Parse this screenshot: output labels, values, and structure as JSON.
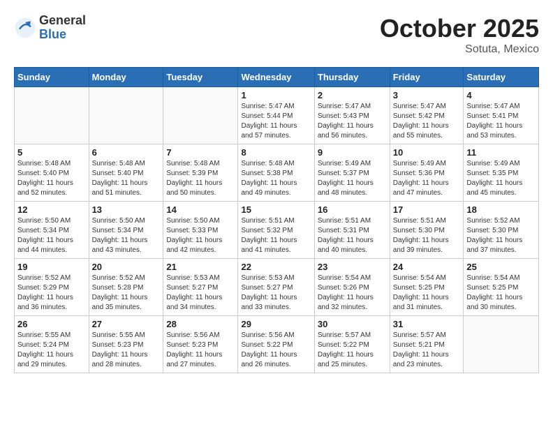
{
  "logo": {
    "general": "General",
    "blue": "Blue"
  },
  "title": "October 2025",
  "subtitle": "Sotuta, Mexico",
  "days_of_week": [
    "Sunday",
    "Monday",
    "Tuesday",
    "Wednesday",
    "Thursday",
    "Friday",
    "Saturday"
  ],
  "weeks": [
    [
      {
        "day": "",
        "info": ""
      },
      {
        "day": "",
        "info": ""
      },
      {
        "day": "",
        "info": ""
      },
      {
        "day": "1",
        "info": "Sunrise: 5:47 AM\nSunset: 5:44 PM\nDaylight: 11 hours\nand 57 minutes."
      },
      {
        "day": "2",
        "info": "Sunrise: 5:47 AM\nSunset: 5:43 PM\nDaylight: 11 hours\nand 56 minutes."
      },
      {
        "day": "3",
        "info": "Sunrise: 5:47 AM\nSunset: 5:42 PM\nDaylight: 11 hours\nand 55 minutes."
      },
      {
        "day": "4",
        "info": "Sunrise: 5:47 AM\nSunset: 5:41 PM\nDaylight: 11 hours\nand 53 minutes."
      }
    ],
    [
      {
        "day": "5",
        "info": "Sunrise: 5:48 AM\nSunset: 5:40 PM\nDaylight: 11 hours\nand 52 minutes."
      },
      {
        "day": "6",
        "info": "Sunrise: 5:48 AM\nSunset: 5:40 PM\nDaylight: 11 hours\nand 51 minutes."
      },
      {
        "day": "7",
        "info": "Sunrise: 5:48 AM\nSunset: 5:39 PM\nDaylight: 11 hours\nand 50 minutes."
      },
      {
        "day": "8",
        "info": "Sunrise: 5:48 AM\nSunset: 5:38 PM\nDaylight: 11 hours\nand 49 minutes."
      },
      {
        "day": "9",
        "info": "Sunrise: 5:49 AM\nSunset: 5:37 PM\nDaylight: 11 hours\nand 48 minutes."
      },
      {
        "day": "10",
        "info": "Sunrise: 5:49 AM\nSunset: 5:36 PM\nDaylight: 11 hours\nand 47 minutes."
      },
      {
        "day": "11",
        "info": "Sunrise: 5:49 AM\nSunset: 5:35 PM\nDaylight: 11 hours\nand 45 minutes."
      }
    ],
    [
      {
        "day": "12",
        "info": "Sunrise: 5:50 AM\nSunset: 5:34 PM\nDaylight: 11 hours\nand 44 minutes."
      },
      {
        "day": "13",
        "info": "Sunrise: 5:50 AM\nSunset: 5:34 PM\nDaylight: 11 hours\nand 43 minutes."
      },
      {
        "day": "14",
        "info": "Sunrise: 5:50 AM\nSunset: 5:33 PM\nDaylight: 11 hours\nand 42 minutes."
      },
      {
        "day": "15",
        "info": "Sunrise: 5:51 AM\nSunset: 5:32 PM\nDaylight: 11 hours\nand 41 minutes."
      },
      {
        "day": "16",
        "info": "Sunrise: 5:51 AM\nSunset: 5:31 PM\nDaylight: 11 hours\nand 40 minutes."
      },
      {
        "day": "17",
        "info": "Sunrise: 5:51 AM\nSunset: 5:30 PM\nDaylight: 11 hours\nand 39 minutes."
      },
      {
        "day": "18",
        "info": "Sunrise: 5:52 AM\nSunset: 5:30 PM\nDaylight: 11 hours\nand 37 minutes."
      }
    ],
    [
      {
        "day": "19",
        "info": "Sunrise: 5:52 AM\nSunset: 5:29 PM\nDaylight: 11 hours\nand 36 minutes."
      },
      {
        "day": "20",
        "info": "Sunrise: 5:52 AM\nSunset: 5:28 PM\nDaylight: 11 hours\nand 35 minutes."
      },
      {
        "day": "21",
        "info": "Sunrise: 5:53 AM\nSunset: 5:27 PM\nDaylight: 11 hours\nand 34 minutes."
      },
      {
        "day": "22",
        "info": "Sunrise: 5:53 AM\nSunset: 5:27 PM\nDaylight: 11 hours\nand 33 minutes."
      },
      {
        "day": "23",
        "info": "Sunrise: 5:54 AM\nSunset: 5:26 PM\nDaylight: 11 hours\nand 32 minutes."
      },
      {
        "day": "24",
        "info": "Sunrise: 5:54 AM\nSunset: 5:25 PM\nDaylight: 11 hours\nand 31 minutes."
      },
      {
        "day": "25",
        "info": "Sunrise: 5:54 AM\nSunset: 5:25 PM\nDaylight: 11 hours\nand 30 minutes."
      }
    ],
    [
      {
        "day": "26",
        "info": "Sunrise: 5:55 AM\nSunset: 5:24 PM\nDaylight: 11 hours\nand 29 minutes."
      },
      {
        "day": "27",
        "info": "Sunrise: 5:55 AM\nSunset: 5:23 PM\nDaylight: 11 hours\nand 28 minutes."
      },
      {
        "day": "28",
        "info": "Sunrise: 5:56 AM\nSunset: 5:23 PM\nDaylight: 11 hours\nand 27 minutes."
      },
      {
        "day": "29",
        "info": "Sunrise: 5:56 AM\nSunset: 5:22 PM\nDaylight: 11 hours\nand 26 minutes."
      },
      {
        "day": "30",
        "info": "Sunrise: 5:57 AM\nSunset: 5:22 PM\nDaylight: 11 hours\nand 25 minutes."
      },
      {
        "day": "31",
        "info": "Sunrise: 5:57 AM\nSunset: 5:21 PM\nDaylight: 11 hours\nand 23 minutes."
      },
      {
        "day": "",
        "info": ""
      }
    ]
  ]
}
